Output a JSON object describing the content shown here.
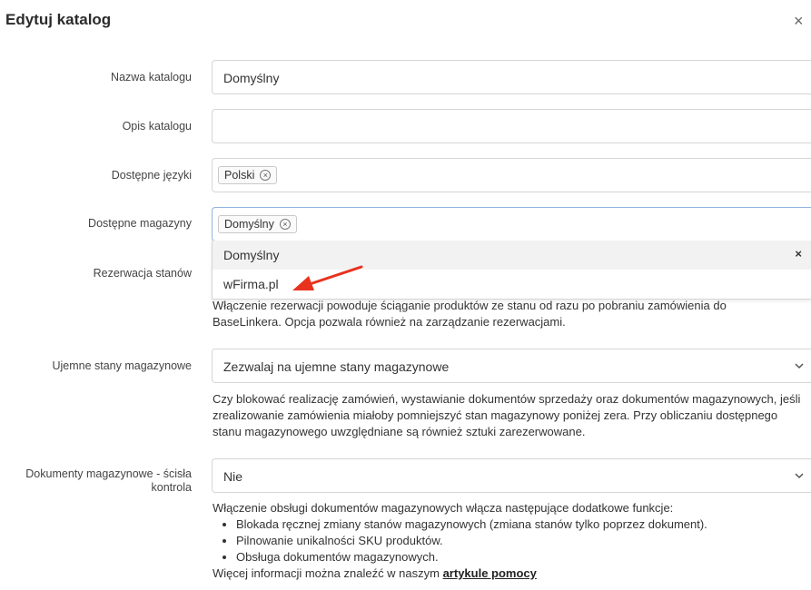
{
  "modal": {
    "title": "Edytuj katalog",
    "close_symbol": "×"
  },
  "fields": {
    "name": {
      "label": "Nazwa katalogu",
      "value": "Domyślny"
    },
    "description": {
      "label": "Opis katalogu",
      "value": ""
    },
    "languages": {
      "label": "Dostępne języki",
      "tags": [
        "Polski"
      ]
    },
    "warehouses": {
      "label": "Dostępne magazyny",
      "tags": [
        "Domyślny"
      ],
      "dropdown_options": [
        "Domyślny",
        "wFirma.pl"
      ],
      "dropdown_clear_symbol": "×"
    },
    "reservation": {
      "label": "Rezerwacja stanów",
      "help": "Włączenie rezerwacji powoduje ściąganie produktów ze stanu od razu po pobraniu zamówienia do BaseLinkera. Opcja pozwala również na zarządzanie rezerwacjami."
    },
    "negative_stock": {
      "label": "Ujemne stany magazynowe",
      "value": "Zezwalaj na ujemne stany magazynowe",
      "help": "Czy blokować realizację zamówień, wystawianie dokumentów sprzedaży oraz dokumentów magazynowych, jeśli zrealizowanie zamówienia miałoby pomniejszyć stan magazynowy poniżej zera. Przy obliczaniu dostępnego stanu magazynowego uwzględniane są również sztuki zarezerwowane."
    },
    "strict_docs": {
      "label": "Dokumenty magazynowe - ścisła kontrola",
      "value": "Nie",
      "help_intro": "Włączenie obsługi dokumentów magazynowych włącza następujące dodatkowe funkcje:",
      "help_items": [
        "Blokada ręcznej zmiany stanów magazynowych (zmiana stanów tylko poprzez dokument).",
        "Pilnowanie unikalności SKU produktów.",
        "Obsługa dokumentów magazynowych."
      ],
      "help_more": "Więcej informacji można znaleźć w naszym ",
      "help_link": "artykule pomocy"
    }
  },
  "colors": {
    "annotation_arrow": "#e8321e"
  }
}
